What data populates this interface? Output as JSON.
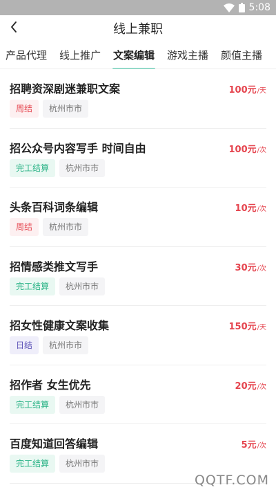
{
  "status_bar": {
    "time": "5:08"
  },
  "header": {
    "title": "线上兼职"
  },
  "tabs": [
    {
      "label": "产品代理",
      "active": false
    },
    {
      "label": "线上推广",
      "active": false
    },
    {
      "label": "文案编辑",
      "active": true
    },
    {
      "label": "游戏主播",
      "active": false
    },
    {
      "label": "颜值主播",
      "active": false
    }
  ],
  "jobs": [
    {
      "title": "招聘资深剧迷兼职文案",
      "salary": "100元",
      "unit": "/天",
      "settlement": "周结",
      "settlement_type": "weekly",
      "city": "杭州市市"
    },
    {
      "title": "招公众号内容写手 时间自由",
      "salary": "100元",
      "unit": "/次",
      "settlement": "完工结算",
      "settlement_type": "finish",
      "city": "杭州市市"
    },
    {
      "title": "头条百科词条编辑",
      "salary": "10元",
      "unit": "/次",
      "settlement": "周结",
      "settlement_type": "weekly",
      "city": "杭州市市"
    },
    {
      "title": "招情感类推文写手",
      "salary": "30元",
      "unit": "/次",
      "settlement": "完工结算",
      "settlement_type": "finish",
      "city": "杭州市市"
    },
    {
      "title": "招女性健康文案收集",
      "salary": "150元",
      "unit": "/天",
      "settlement": "日结",
      "settlement_type": "daily",
      "city": "杭州市市"
    },
    {
      "title": "招作者 女生优先",
      "salary": "20元",
      "unit": "/次",
      "settlement": "完工结算",
      "settlement_type": "finish",
      "city": "杭州市市"
    },
    {
      "title": "百度知道回答编辑",
      "salary": "5元",
      "unit": "/次",
      "settlement": "完工结算",
      "settlement_type": "finish",
      "city": "杭州市市"
    }
  ],
  "watermark": "QQTF.COM",
  "colors": {
    "accent": "#3cc6a6",
    "salary": "#e5454f",
    "status_bar": "#b3b3b3"
  }
}
